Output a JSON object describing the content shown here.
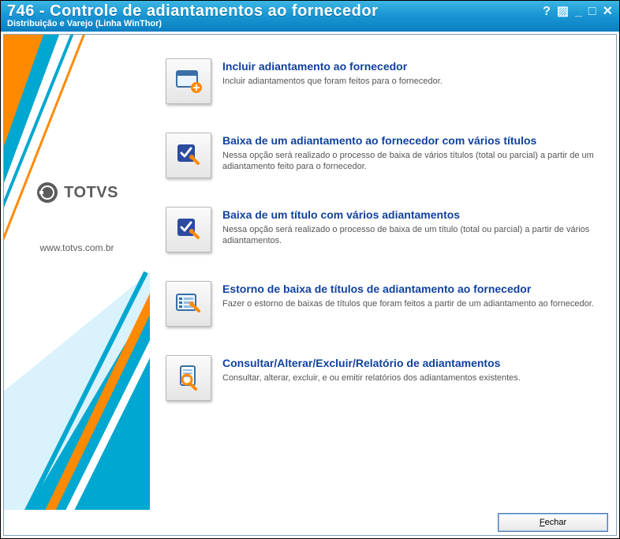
{
  "window": {
    "title": "746 - Controle de adiantamentos ao fornecedor",
    "subtitle": "Distribuição e Varejo (Linha WinThor)"
  },
  "brand": {
    "name": "TOTVS",
    "url": "www.totvs.com.br"
  },
  "options": [
    {
      "icon": "window-add",
      "title": "Incluir adiantamento ao fornecedor",
      "desc": "Incluir adiantamentos que foram feitos para o fornecedor."
    },
    {
      "icon": "check-wrench",
      "title": "Baixa de um adiantamento ao fornecedor com vários títulos",
      "desc": "Nessa opção será realizado o processo de baixa de vários títulos (total ou parcial) a partir de um adiantamento feito para o fornecedor."
    },
    {
      "icon": "check-wrench",
      "title": "Baixa de um título com vários adiantamentos",
      "desc": "Nessa opção será realizado o processo de baixa de um título (total ou parcial) a partir de vários adiantamentos."
    },
    {
      "icon": "list-wrench",
      "title": "Estorno de baixa de títulos de adiantamento ao fornecedor",
      "desc": "Fazer o estorno de baixas de títulos que foram feitos a partir de um adiantamento ao fornecedor."
    },
    {
      "icon": "search-doc",
      "title": "Consultar/Alterar/Excluir/Relatório de adiantamentos",
      "desc": "Consultar, alterar, excluir, e ou emitir relatórios dos adiantamentos existentes."
    }
  ],
  "buttons": {
    "close_label": "Fechar",
    "close_hotkey_prefix": "F"
  }
}
